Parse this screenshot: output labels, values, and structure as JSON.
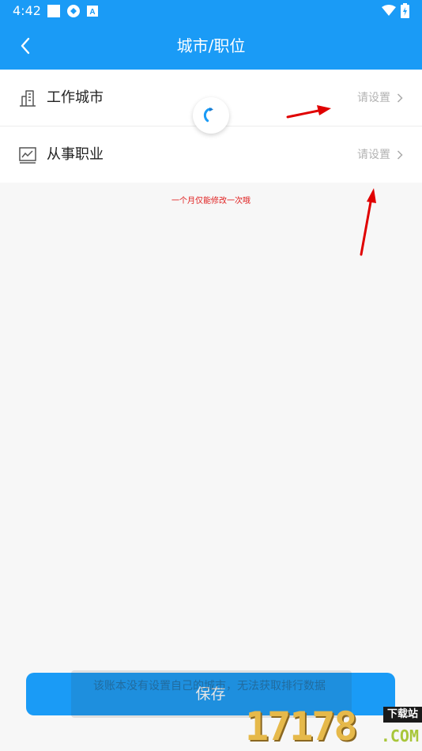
{
  "status_bar": {
    "time": "4:42",
    "icons": [
      "notification-square-icon",
      "app-badge-icon",
      "font-a-icon",
      "wifi-icon",
      "battery-charging-icon"
    ]
  },
  "header": {
    "title": "城市/职位",
    "back_icon": "chevron-left-icon",
    "background": "#1a9bf6"
  },
  "settings": {
    "rows": [
      {
        "label": "工作城市",
        "value": "请设置",
        "icon": "building-icon"
      },
      {
        "label": "从事职业",
        "value": "请设置",
        "icon": "chart-line-icon"
      }
    ]
  },
  "notice": "一个月仅能修改一次哦",
  "save_button": {
    "label": "保存"
  },
  "toast": {
    "text": "该账本没有设置自己的城市，无法获取排行数据"
  },
  "watermark": {
    "digits": "17178",
    "tag": "下载站",
    "suffix": ".COM"
  },
  "colors": {
    "accent": "#1a9bf6",
    "notice": "#e02020",
    "arrow": "#e00000"
  }
}
